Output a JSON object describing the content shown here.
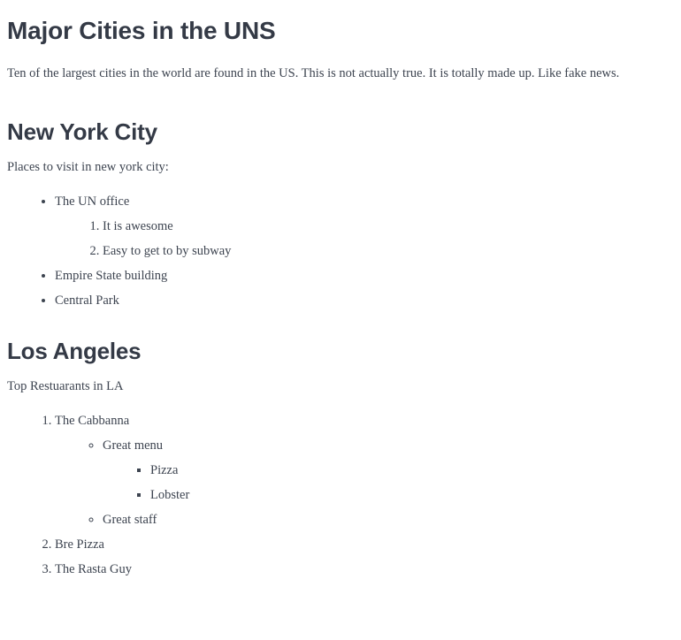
{
  "title": "Major Cities in the UNS",
  "intro": "Ten of the largest cities in the world are found in the US. This is not actually true. It is totally made up. Like fake news.",
  "nyc": {
    "heading": "New York City",
    "subtitle": "Places to visit in new york city:",
    "items": [
      {
        "label": "The UN office",
        "sub": [
          "It is awesome",
          "Easy to get to by subway"
        ]
      },
      {
        "label": "Empire State building"
      },
      {
        "label": "Central Park"
      }
    ]
  },
  "la": {
    "heading": "Los Angeles",
    "subtitle": "Top Restuarants in LA",
    "items": [
      {
        "label": "The Cabbanna",
        "sub": [
          {
            "label": "Great menu",
            "sub": [
              "Pizza",
              "Lobster"
            ]
          },
          {
            "label": "Great staff"
          }
        ]
      },
      {
        "label": "Bre Pizza"
      },
      {
        "label": "The Rasta Guy"
      }
    ]
  }
}
